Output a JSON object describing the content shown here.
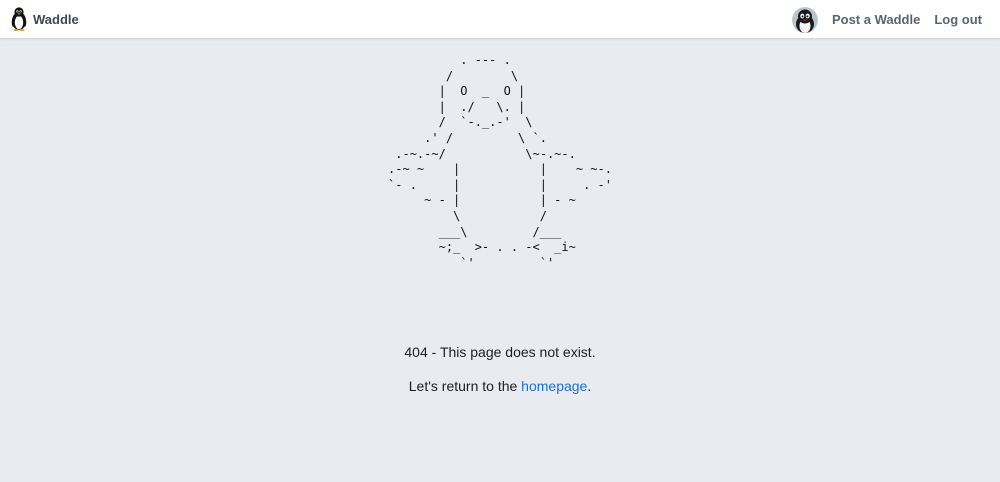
{
  "navbar": {
    "brand_name": "Waddle",
    "brand_icon": "penguin-logo-icon",
    "avatar_icon": "user-avatar-penguin",
    "post_label": "Post a Waddle",
    "logout_label": "Log out"
  },
  "main": {
    "ascii_art": "          . --- .\n        /        \\\n       |  O  _  O |\n       |  ./   \\. |\n       /  `-._.-'  \\\n     .' /         \\ `.\n .-~.-~/           \\~-.~-.\n.-~ ~    |           |    ~ ~-.\n`- .     |           |     . -'\n     ~ - |           | - ~\n         \\           /\n       ___\\         /___\n       ~;_  >- . . -<  _i~\n          `'         `'",
    "error_message": "404 - This page does not exist.",
    "return_prefix": "Let's return to the ",
    "return_link": "homepage",
    "return_suffix": "."
  },
  "colors": {
    "background": "#e8ecf0",
    "navbar": "#ffffff",
    "link": "#1a6fd6",
    "nav_text": "#5a6370"
  }
}
